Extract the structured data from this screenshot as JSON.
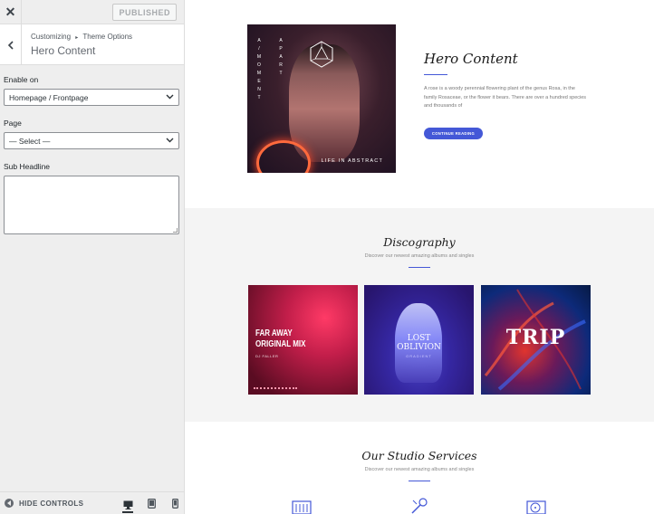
{
  "topbar": {
    "close_label": "✕",
    "publish_label": "PUBLISHED"
  },
  "section": {
    "breadcrumb_root": "Customizing",
    "breadcrumb_sep": "▸",
    "breadcrumb_parent": "Theme Options",
    "title": "Hero Content"
  },
  "controls": {
    "enable_on": {
      "label": "Enable on",
      "value": "Homepage / Frontpage"
    },
    "page": {
      "label": "Page",
      "value": "— Select —"
    },
    "sub_headline": {
      "label": "Sub Headline",
      "value": ""
    }
  },
  "footer": {
    "hide_controls_label": "HIDE CONTROLS",
    "devices": [
      "desktop-icon",
      "tablet-icon",
      "mobile-icon"
    ],
    "active_device": "desktop"
  },
  "preview": {
    "hero": {
      "title": "Hero Content",
      "text": "A rose is a woody perennial flowering plant of the genus Rosa, in the family Rosaceae, or the flower it bears. There are over a hundred species and thousands of",
      "button": "CONTINUE READING",
      "image_vertical_left": [
        "A",
        "/",
        "M",
        "O",
        "M",
        "E",
        "N",
        "T"
      ],
      "image_vertical_right": [
        "A",
        "P",
        "A",
        "R",
        "T"
      ],
      "image_tag": "LIFE IN ABSTRACT"
    },
    "discography": {
      "title": "Discography",
      "subtitle": "Discover our newest amazing albums and singles",
      "albums": [
        {
          "title": "FAR AWAY ORIGINAL MIX",
          "artist": "DJ FALLER"
        },
        {
          "title": "LOST OBLIVION",
          "artist": "GRADIENT"
        },
        {
          "title": "TRIP",
          "artist": ""
        }
      ]
    },
    "services": {
      "title": "Our Studio Services",
      "subtitle": "Discover our newest amazing albums and singles"
    }
  },
  "colors": {
    "accent": "#4458d7",
    "sidebar_bg": "#eeeeee",
    "section_bg": "#f4f4f4"
  }
}
